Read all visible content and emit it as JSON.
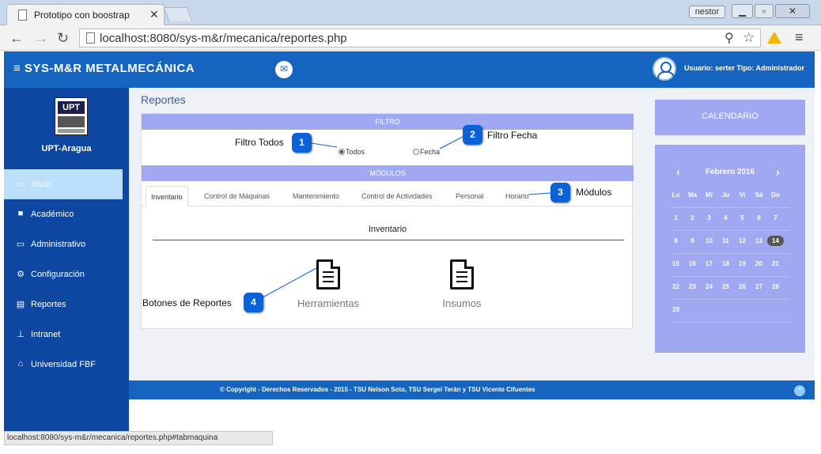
{
  "browser": {
    "tab_title": "Prototipo con boostrap",
    "tab_close": "✕",
    "profile": "nestor",
    "url": "localhost:8080/sys-m&r/mecanica/reportes.php",
    "status_url": "localhost:8080/sys-m&r/mecanica/reportes.php#tabmaquina"
  },
  "header": {
    "brand": "SYS-M&R  METALMECÁNICA",
    "user_info": "Usuario: serter   Tipo: Administrador"
  },
  "sidebar": {
    "org_logo_text": "UPT",
    "org_name": "UPT-Aragua",
    "items": [
      {
        "label": "Inicio",
        "icon": "folder-open-icon",
        "active": true
      },
      {
        "label": "Académico",
        "icon": "book-icon"
      },
      {
        "label": "Administrativo",
        "icon": "monitor-icon"
      },
      {
        "label": "Configuración",
        "icon": "gears-icon"
      },
      {
        "label": "Reportes",
        "icon": "file-text-icon"
      },
      {
        "label": "Intranet",
        "icon": "sitemap-icon"
      },
      {
        "label": "Universidad FBF",
        "icon": "institution-icon"
      }
    ]
  },
  "main": {
    "breadcrumb": "Reportes",
    "filter": {
      "heading": "FILTRO",
      "options": [
        {
          "label": "Todos",
          "checked": true
        },
        {
          "label": "Fecha",
          "checked": false
        }
      ]
    },
    "modules": {
      "heading": "MÓDULOS",
      "tabs": [
        "Inventario",
        "Control de Máquinas",
        "Mantenimiento",
        "Control de Actividades",
        "Personal",
        "Horario"
      ],
      "active_tab": "Inventario"
    },
    "panel_title": "Inventario",
    "report_buttons": [
      {
        "label": "Herramientas",
        "icon": "file-text-icon"
      },
      {
        "label": "Insumos",
        "icon": "file-text-icon"
      }
    ]
  },
  "calendar": {
    "heading": "CALENDARIO",
    "month": "Febrero 2016",
    "weekdays": [
      "Lu",
      "Ma",
      "Mi",
      "Ju",
      "Vi",
      "Sá",
      "Do"
    ],
    "weeks": [
      [
        "1",
        "2",
        "3",
        "4",
        "5",
        "6",
        "7"
      ],
      [
        "8",
        "9",
        "10",
        "11",
        "12",
        "13",
        "14"
      ],
      [
        "15",
        "16",
        "17",
        "18",
        "19",
        "20",
        "21"
      ],
      [
        "22",
        "23",
        "24",
        "25",
        "26",
        "27",
        "28"
      ],
      [
        "29",
        "",
        "",
        "",
        "",
        "",
        ""
      ]
    ],
    "today": "14"
  },
  "footer": {
    "text": "© Copyright - Derechos Reservados - 2015 - TSU Nelson Soto, TSU Sergei Terán y TSU Vicente Cifuentes"
  },
  "annotations": [
    {
      "number": "1",
      "label": "Filtro Todos"
    },
    {
      "number": "2",
      "label": "Filtro Fecha"
    },
    {
      "number": "3",
      "label": "Módulos"
    },
    {
      "number": "4",
      "label": "Botones de Reportes"
    }
  ]
}
